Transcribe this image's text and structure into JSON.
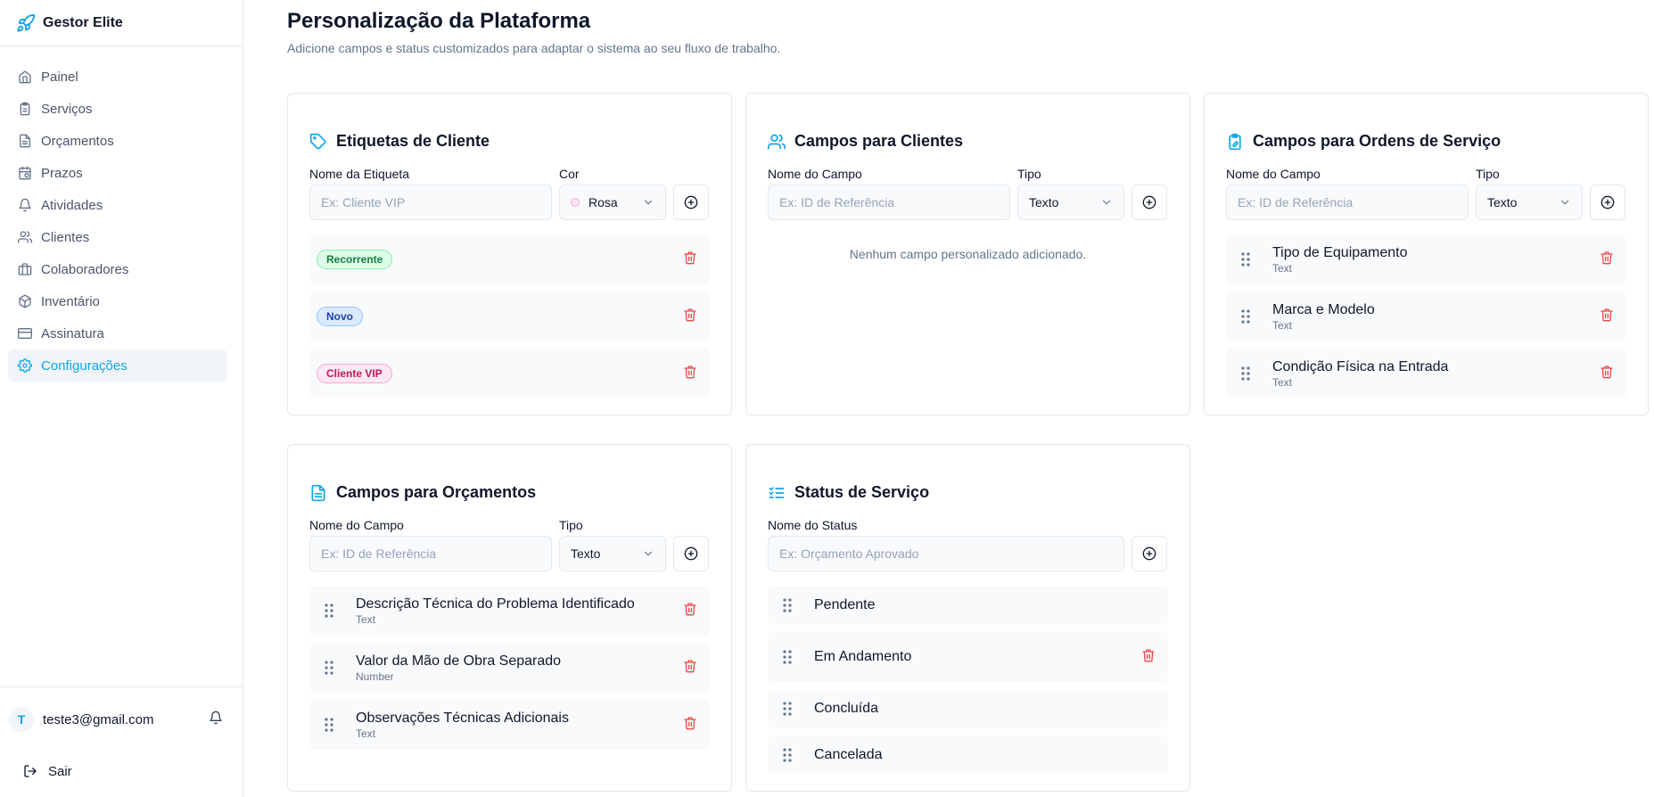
{
  "app": {
    "name": "Gestor Elite"
  },
  "sidebar": {
    "items": [
      {
        "label": "Painel",
        "icon": "home-icon"
      },
      {
        "label": "Serviços",
        "icon": "clipboard-icon"
      },
      {
        "label": "Orçamentos",
        "icon": "file-text-icon"
      },
      {
        "label": "Prazos",
        "icon": "calendar-clock-icon"
      },
      {
        "label": "Atividades",
        "icon": "bell-icon"
      },
      {
        "label": "Clientes",
        "icon": "users-icon"
      },
      {
        "label": "Colaboradores",
        "icon": "briefcase-icon"
      },
      {
        "label": "Inventário",
        "icon": "package-icon"
      },
      {
        "label": "Assinatura",
        "icon": "credit-card-icon"
      },
      {
        "label": "Configurações",
        "icon": "settings-icon",
        "active": true
      }
    ],
    "user": {
      "initial": "T",
      "email": "teste3@gmail.com"
    },
    "logout_label": "Sair"
  },
  "header": {
    "title": "Personalização da Plataforma",
    "subtitle": "Adicione campos e status customizados para adaptar o sistema ao seu fluxo de trabalho."
  },
  "tags_card": {
    "title": "Etiquetas de Cliente",
    "name_label": "Nome da Etiqueta",
    "name_placeholder": "Ex: Cliente VIP",
    "color_label": "Cor",
    "color_value": "Rosa",
    "tags": [
      {
        "label": "Recorrente",
        "color": "#dcfce7"
      },
      {
        "label": "Novo",
        "color": "#dbeafe"
      },
      {
        "label": "Cliente VIP",
        "color": "#fce7f3"
      }
    ]
  },
  "client_fields_card": {
    "title": "Campos para Clientes",
    "name_label": "Nome do Campo",
    "name_placeholder": "Ex: ID de Referência",
    "type_label": "Tipo",
    "type_value": "Texto",
    "empty_text": "Nenhum campo personalizado adicionado."
  },
  "order_fields_card": {
    "title": "Campos para Ordens de Serviço",
    "name_label": "Nome do Campo",
    "name_placeholder": "Ex: ID de Referência",
    "type_label": "Tipo",
    "type_value": "Texto",
    "fields": [
      {
        "name": "Tipo de Equipamento",
        "type": "Text"
      },
      {
        "name": "Marca e Modelo",
        "type": "Text"
      },
      {
        "name": "Condição Física na Entrada",
        "type": "Text"
      }
    ]
  },
  "quote_fields_card": {
    "title": "Campos para Orçamentos",
    "name_label": "Nome do Campo",
    "name_placeholder": "Ex: ID de Referência",
    "type_label": "Tipo",
    "type_value": "Texto",
    "fields": [
      {
        "name": "Descrição Técnica do Problema Identificado",
        "type": "Text"
      },
      {
        "name": "Valor da Mão de Obra Separado",
        "type": "Number"
      },
      {
        "name": "Observações Técnicas Adicionais",
        "type": "Text"
      }
    ]
  },
  "status_card": {
    "title": "Status de Serviço",
    "name_label": "Nome do Status",
    "name_placeholder": "Ex: Orçamento Aprovado",
    "statuses": [
      {
        "name": "Pendente",
        "deletable": false
      },
      {
        "name": "Em Andamento",
        "deletable": true
      },
      {
        "name": "Concluída",
        "deletable": false
      },
      {
        "name": "Cancelada",
        "deletable": false
      }
    ]
  },
  "colors": {
    "accent": "#0ea5e9",
    "danger": "#ef4444"
  }
}
